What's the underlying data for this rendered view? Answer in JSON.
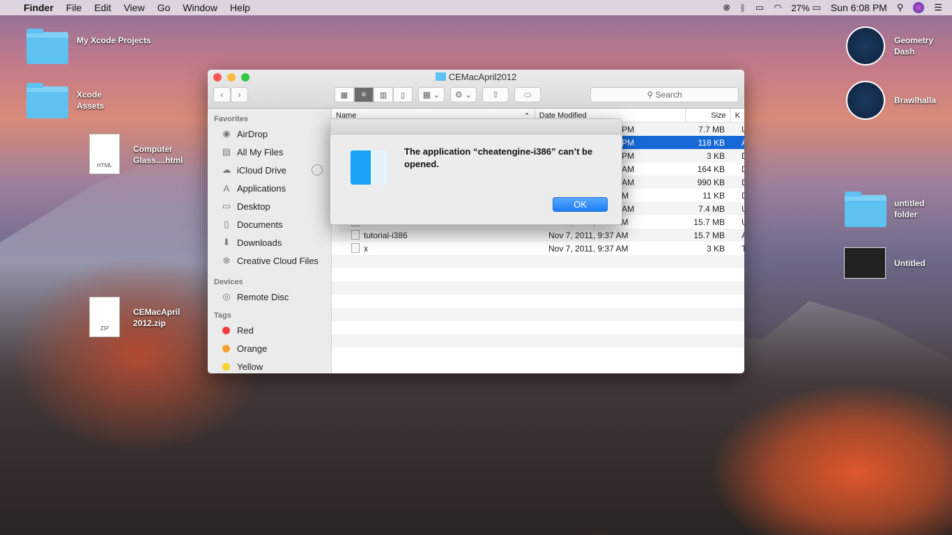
{
  "menubar": {
    "items": [
      "Finder",
      "File",
      "Edit",
      "View",
      "Go",
      "Window",
      "Help"
    ],
    "battery": "27%",
    "clock": "Sun 6:08 PM"
  },
  "desktop": {
    "icons": [
      {
        "label": "My Xcode Projects"
      },
      {
        "label": "Xcode Assets"
      },
      {
        "label": "Computer Glass....html",
        "badge": "HTML"
      },
      {
        "label": "CEMacApril 2012.zip",
        "badge": "ZIP"
      },
      {
        "label": "Geometry Dash"
      },
      {
        "label": "Brawlhalla"
      },
      {
        "label": "untitled folder"
      },
      {
        "label": "Untitled"
      }
    ]
  },
  "finder": {
    "title": "CEMacApril2012",
    "search_placeholder": "Search",
    "sidebar": {
      "favorites_header": "Favorites",
      "favorites": [
        {
          "label": "AirDrop",
          "icon": "airdrop-icon"
        },
        {
          "label": "All My Files",
          "icon": "files-icon"
        },
        {
          "label": "iCloud Drive",
          "icon": "cloud-icon"
        },
        {
          "label": "Applications",
          "icon": "applications-icon"
        },
        {
          "label": "Desktop",
          "icon": "desktop-icon"
        },
        {
          "label": "Documents",
          "icon": "documents-icon"
        },
        {
          "label": "Downloads",
          "icon": "downloads-icon"
        },
        {
          "label": "Creative Cloud Files",
          "icon": "creative-cloud-icon"
        }
      ],
      "devices_header": "Devices",
      "devices": [
        {
          "label": "Remote Disc"
        }
      ],
      "tags_header": "Tags",
      "tags": [
        {
          "label": "Red",
          "color": "#f23c3c"
        },
        {
          "label": "Orange",
          "color": "#f7a030"
        },
        {
          "label": "Yellow",
          "color": "#f5d22a"
        }
      ]
    },
    "columns": {
      "name": "Name",
      "date": "Date Modified",
      "size": "Size",
      "kind": "K"
    },
    "rows": [
      {
        "name": "",
        "date": "PM",
        "size": "7.7 MB",
        "kind": "U"
      },
      {
        "name": "",
        "date": "PM",
        "size": "118 KB",
        "kind": "A",
        "selected": true
      },
      {
        "name": "",
        "date": "PM",
        "size": "3 KB",
        "kind": "D"
      },
      {
        "name": "",
        "date": "AM",
        "size": "164 KB",
        "kind": "D"
      },
      {
        "name": "",
        "date": "AM",
        "size": "990 KB",
        "kind": "D"
      },
      {
        "name": "",
        "date": "M",
        "size": "11 KB",
        "kind": "D"
      },
      {
        "name": "",
        "date": "AM",
        "size": "7.4 MB",
        "kind": "U"
      },
      {
        "name": "tutorial-i386",
        "date": "Nov 7, 2011, 9:37 AM",
        "size": "15.7 MB",
        "kind": "U"
      },
      {
        "name": "tutorial-i386",
        "date": "Nov 7, 2011, 9:37 AM",
        "size": "15.7 MB",
        "kind": "A"
      },
      {
        "name": "x",
        "date": "Nov 7, 2011, 9:37 AM",
        "size": "3 KB",
        "kind": "T"
      }
    ]
  },
  "dialog": {
    "message": "The application “cheatengine-i386” can’t be opened.",
    "ok": "OK"
  }
}
